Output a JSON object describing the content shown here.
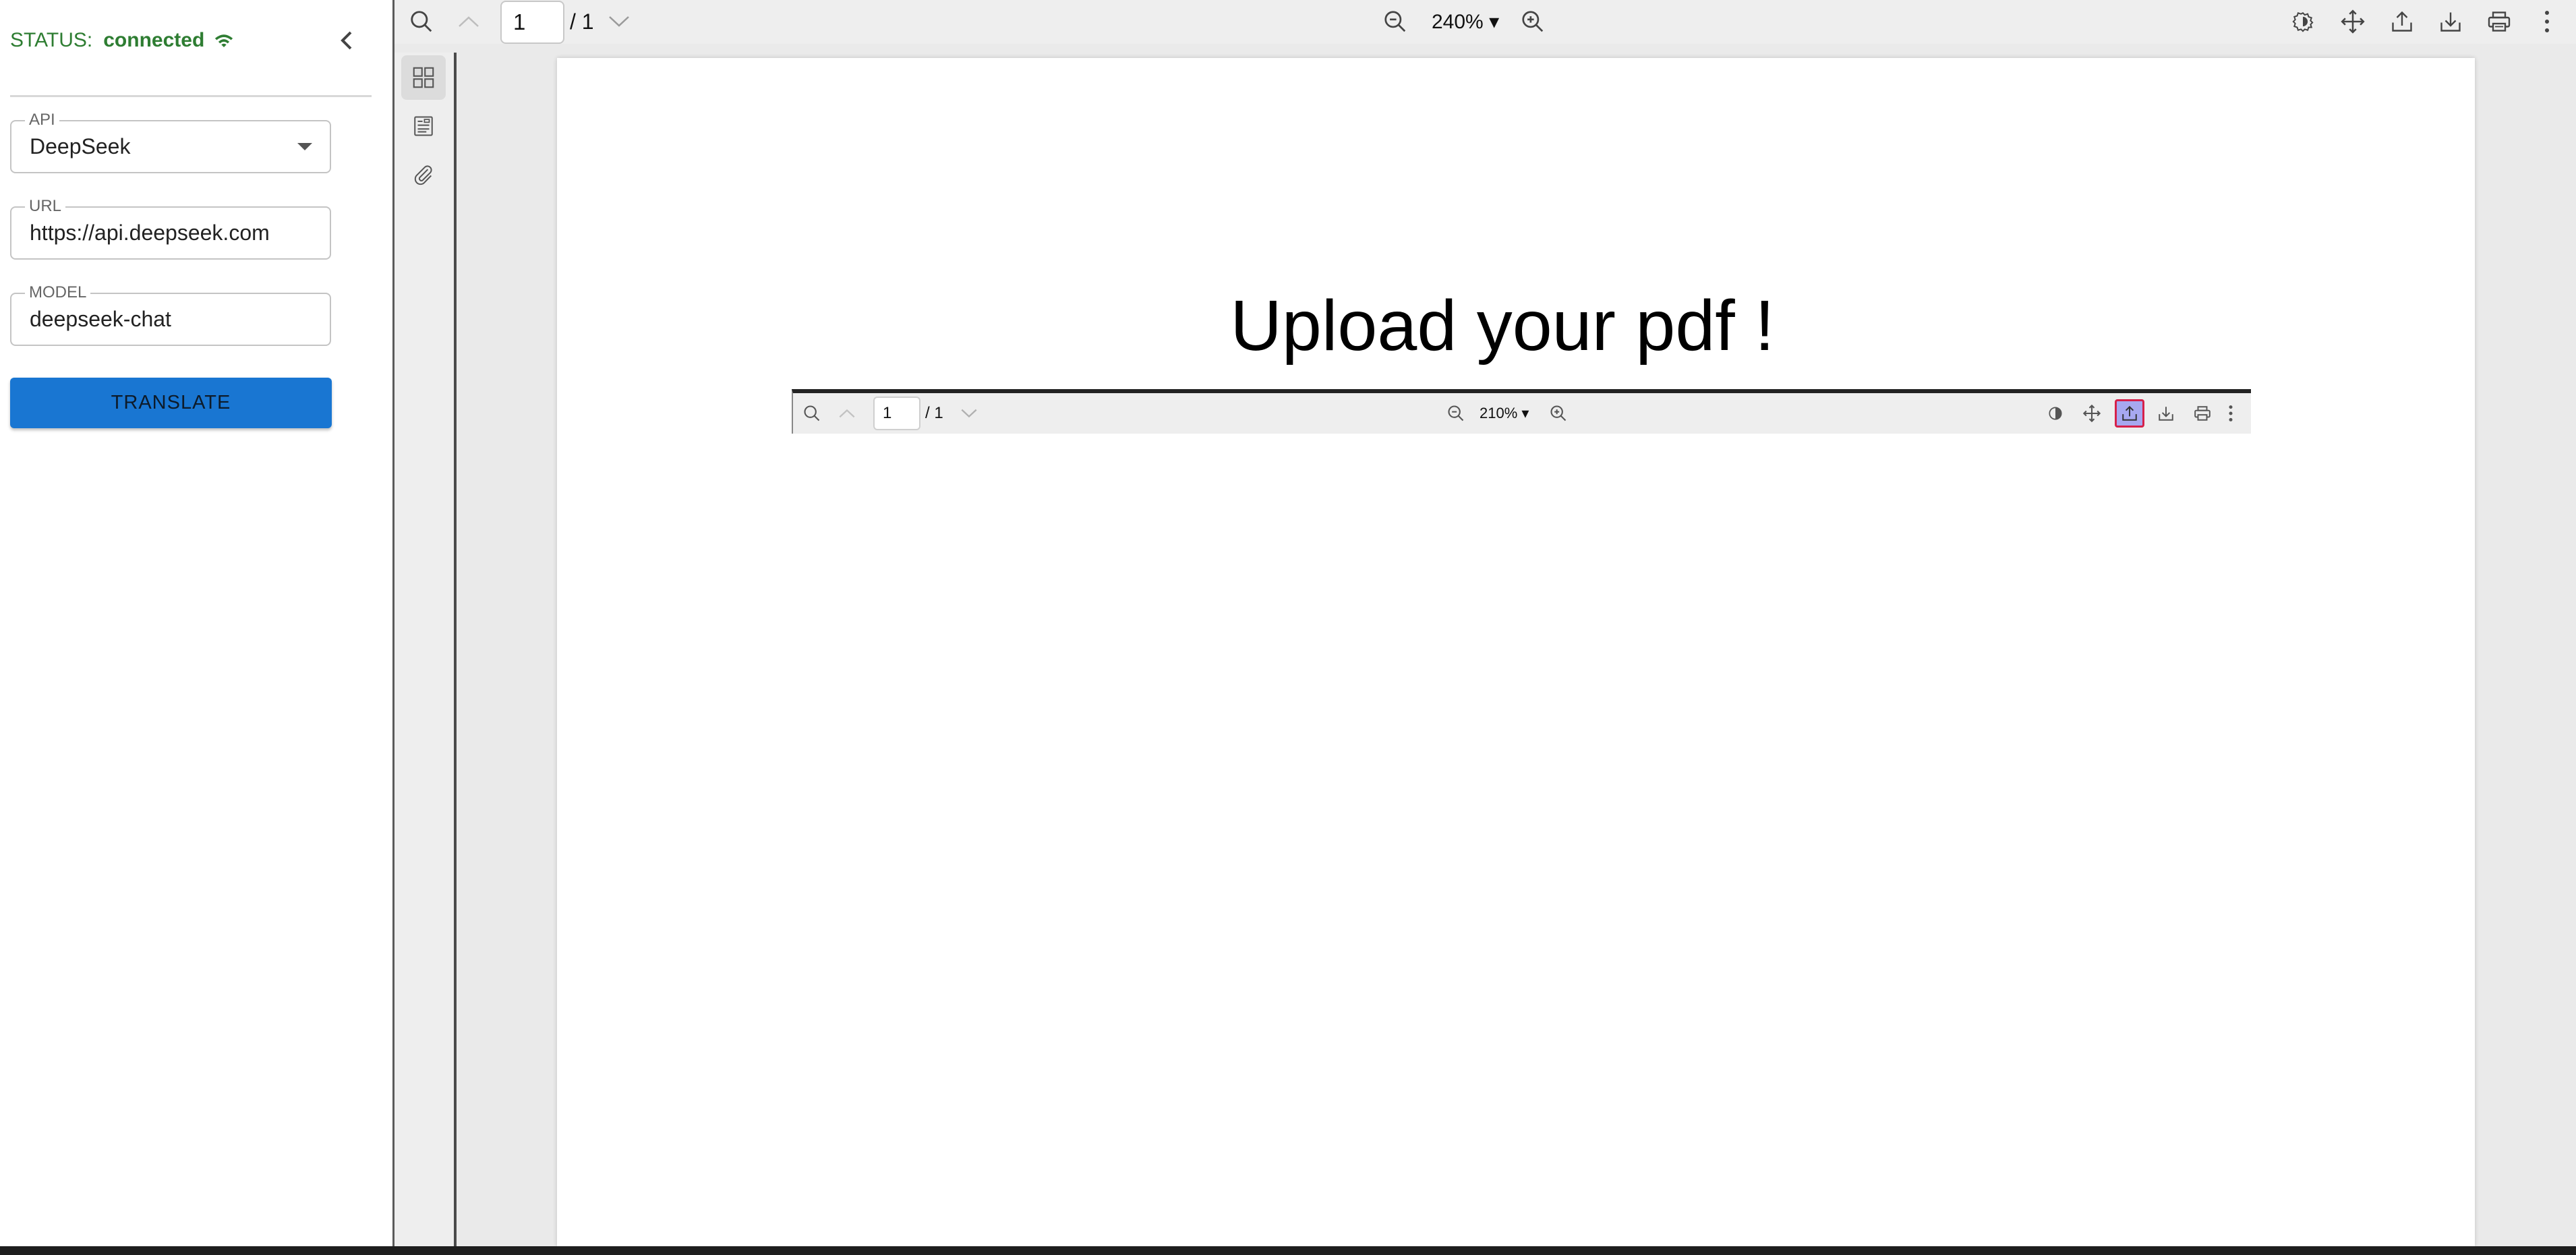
{
  "status": {
    "label": "STATUS:",
    "value": "connected",
    "color": "#2e7d32"
  },
  "settings": {
    "api": {
      "label": "API",
      "value": "DeepSeek"
    },
    "url": {
      "label": "URL",
      "value": "https://api.deepseek.com"
    },
    "model": {
      "label": "MODEL",
      "value": "deepseek-chat"
    },
    "translate_label": "TRANSLATE",
    "accent": "#1976d2"
  },
  "viewer": {
    "page_current": "1",
    "page_total": "/ 1",
    "zoom": "240% ▾",
    "toolbar_icons": [
      "search-icon",
      "previous-page-icon",
      "next-page-icon",
      "zoom-out-icon",
      "zoom-in-icon",
      "theme-icon",
      "pan-icon",
      "upload-icon",
      "download-icon",
      "print-icon",
      "more-vertical-icon"
    ],
    "sidebar_icons": [
      "thumbnails-icon",
      "outline-icon",
      "attachment-icon"
    ]
  },
  "document": {
    "title": "Upload your pdf  !",
    "embedded_toolbar": {
      "page_current": "1",
      "page_total": "/ 1",
      "zoom": "210% ▾",
      "highlighted_button": "upload",
      "highlight_color": "#a7a8f0",
      "highlight_border": "#d6204a"
    }
  }
}
